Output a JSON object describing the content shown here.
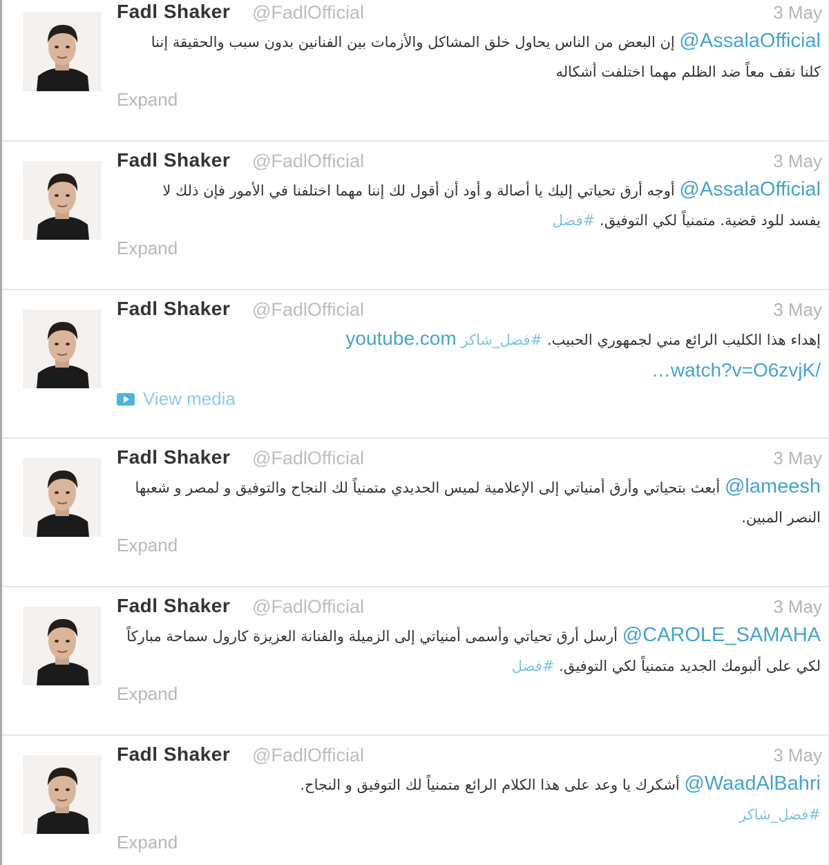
{
  "tweets": [
    {
      "name": "Fadl Shaker",
      "handle": "@FadlOfficial",
      "date": "3 May",
      "mention": "@AssalaOfficial",
      "text": "إن البعض من الناس يحاول خلق المشاكل والأزمات بين الفنانين بدون سبب والحقيقة إننا كلنا نقف معاً ضد الظلم مهما اختلفت أشكاله",
      "hashtag": "",
      "action": "Expand"
    },
    {
      "name": "Fadl Shaker",
      "handle": "@FadlOfficial",
      "date": "3 May",
      "mention": "@AssalaOfficial",
      "text": "أوجه أرق تحياتي إليك يا أصالة و أود أن أقول لك إننا مهما اختلفنا في الأمور فإن ذلك لا يفسد للود قضية. متمنياً لكي التوفيق.",
      "hashtag": "#فضل",
      "action": "Expand"
    },
    {
      "name": "Fadl Shaker",
      "handle": "@FadlOfficial",
      "date": "3 May",
      "mention": "",
      "text": "إهداء هذا الكليب الرائع مني لجمهوري الحبيب.",
      "hashtag": "#فضل_شاكر",
      "link_line1": "youtube.com",
      "link_line2": "/watch?v=O6zvjK…",
      "action": "View media",
      "action_icon": "video-icon"
    },
    {
      "name": "Fadl Shaker",
      "handle": "@FadlOfficial",
      "date": "3 May",
      "mention": "@lameesh",
      "text": "أبعث بتحياتي وأرق أمنياتي إلى الإعلامية لميس الحديدي متمنياً لك النجاح والتوفيق و لمصر و شعبها النصر المبين.",
      "hashtag": "",
      "action": "Expand"
    },
    {
      "name": "Fadl Shaker",
      "handle": "@FadlOfficial",
      "date": "3 May",
      "mention": "@CAROLE_SAMAHA",
      "text": "أرسل أرق تحياتي وأسمى أمنياتي إلى الزميلة والفنانة العزيزة كارول سماحة مباركاً لكي على ألبومك الجديد متمنياً لكي التوفيق.",
      "hashtag": "#فضل",
      "action": "Expand"
    },
    {
      "name": "Fadl Shaker",
      "handle": "@FadlOfficial",
      "date": "3 May",
      "mention": "@WaadAlBahri",
      "text": "أشكرك يا وعد على هذا الكلام الرائع متمنياً لك التوفيق و النجاح.",
      "hashtag": "#فضل_شاكر",
      "action": "Expand"
    }
  ]
}
